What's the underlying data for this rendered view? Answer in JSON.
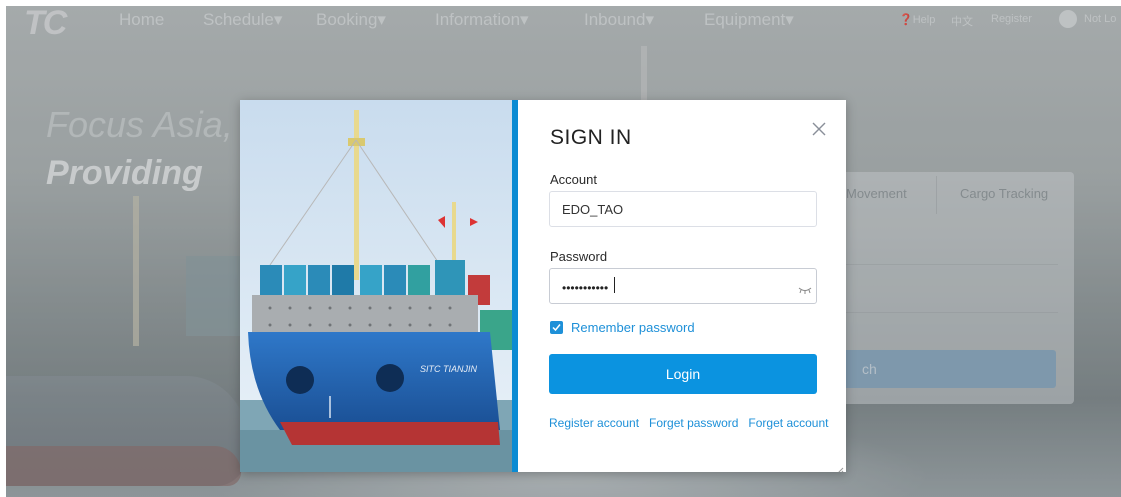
{
  "nav": {
    "logo": "TC",
    "items": [
      {
        "label": "Home"
      },
      {
        "label": "Schedule▾"
      },
      {
        "label": "Booking▾"
      },
      {
        "label": "Information▾"
      },
      {
        "label": "Inbound▾"
      },
      {
        "label": "Equipment▾"
      }
    ],
    "help": "❓Help",
    "language": "中文",
    "register": "Register",
    "user_status": "Not Lo"
  },
  "hero": {
    "line1": "Focus Asia,",
    "line2": "Providing"
  },
  "tracking_panel": {
    "tabs": [
      {
        "label": "Movement"
      },
      {
        "label": "Cargo Tracking"
      }
    ],
    "search_label": "ch"
  },
  "modal": {
    "title": "SIGN IN",
    "account": {
      "label": "Account",
      "value": "EDO_TAO"
    },
    "password": {
      "label": "Password",
      "masked_value": "•••••••••••"
    },
    "remember": {
      "label": "Remember password",
      "checked": true
    },
    "login_label": "Login",
    "links": [
      {
        "label": "Register account"
      },
      {
        "label": "Forget password"
      },
      {
        "label": "Forget account"
      }
    ],
    "ship_name": "SITC TIANJIN"
  },
  "colors": {
    "accent": "#0b93e0",
    "accent_bar": "#0b8bd3",
    "link": "#1e90d8"
  }
}
